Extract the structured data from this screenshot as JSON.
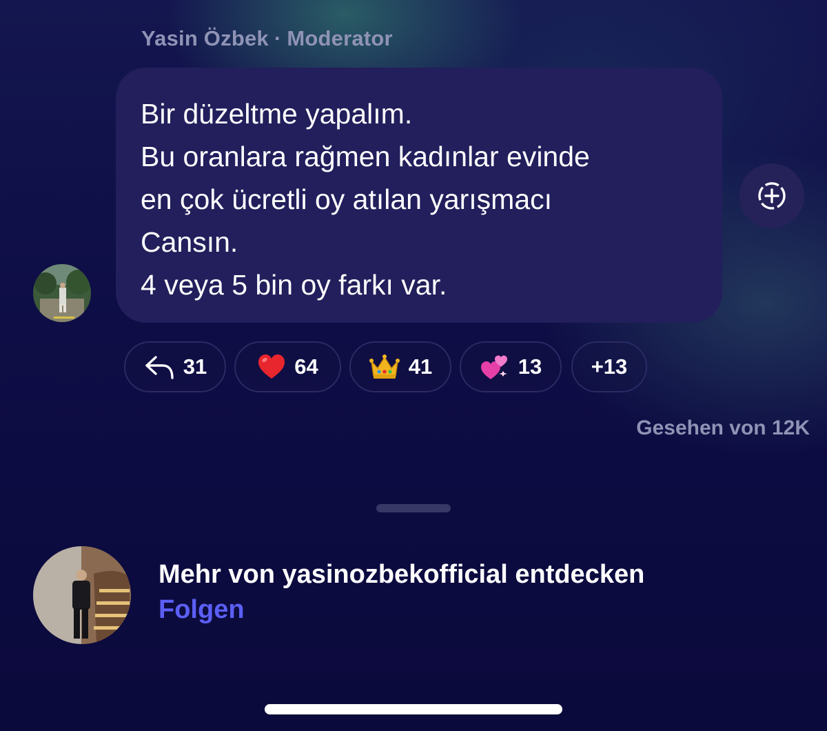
{
  "author": {
    "name": "Yasin Özbek",
    "separator": "·",
    "role": "Moderator"
  },
  "message": {
    "lines": [
      "Bir düzeltme yapalım.",
      "Bu oranlara rağmen kadınlar evinde",
      "en çok ücretli oy atılan yarışmacı",
      "Cansın.",
      "4 veya 5 bin oy farkı var."
    ]
  },
  "reactions": [
    {
      "icon": "reply-icon",
      "count": "31"
    },
    {
      "icon": "heart-emoji",
      "count": "64"
    },
    {
      "icon": "crown-emoji",
      "count": "41"
    },
    {
      "icon": "two-hearts-emoji",
      "count": "13"
    },
    {
      "icon": "",
      "count": "+13"
    }
  ],
  "seen_by": "Gesehen von 12K",
  "footer": {
    "title": "Mehr von yasinozbekofficial entdecken",
    "follow_label": "Folgen"
  },
  "colors": {
    "background": "#0b0a3c",
    "bubble": "#221f5c",
    "muted_text": "#8f93b5",
    "accent": "#5b5ff5"
  }
}
